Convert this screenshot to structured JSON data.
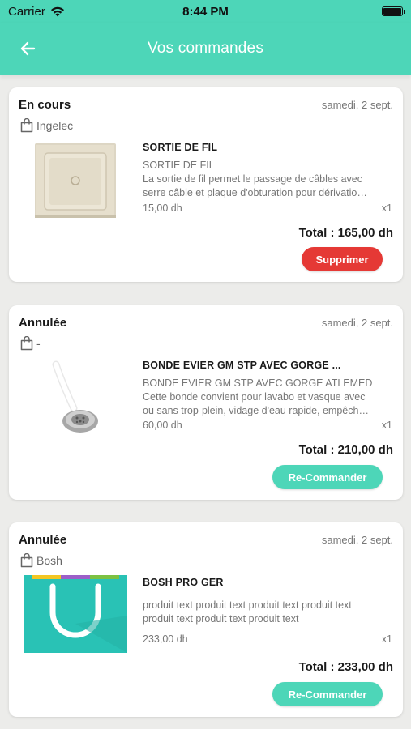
{
  "status_bar": {
    "carrier": "Carrier",
    "time": "8:44 PM"
  },
  "header": {
    "title": "Vos commandes"
  },
  "colors": {
    "accent": "#4dd6b8",
    "danger": "#e53935"
  },
  "orders": [
    {
      "status": "En cours",
      "date": "samedi, 2 sept.",
      "seller": "Ingelec",
      "product_name": "SORTIE DE FIL",
      "product_description": "SORTIE DE FIL\nLa sortie de fil permet le passage de câbles avec serre câble et plaque d'obturation pour dérivatio…",
      "price": "15,00 dh",
      "quantity": "x1",
      "total": "Total : 165,00 dh",
      "action": "Supprimer"
    },
    {
      "status": "Annulée",
      "date": "samedi, 2 sept.",
      "seller": "-",
      "product_name": "BONDE EVIER GM STP AVEC GORGE ...",
      "product_description": "BONDE EVIER GM STP AVEC GORGE ATLEMED\nCette bonde convient pour lavabo et vasque avec ou sans trop-plein, vidage d'eau rapide, empêch…",
      "price": "60,00 dh",
      "quantity": "x1",
      "total": "Total : 210,00 dh",
      "action": "Re-Commander"
    },
    {
      "status": "Annulée",
      "date": "samedi, 2 sept.",
      "seller": "Bosh",
      "product_name": "BOSH PRO GER",
      "product_description": "produit text produit text produit text produit text produit text produit text produit text",
      "price": "233,00 dh",
      "quantity": "x1",
      "total": "Total : 233,00 dh",
      "action": "Re-Commander"
    }
  ]
}
